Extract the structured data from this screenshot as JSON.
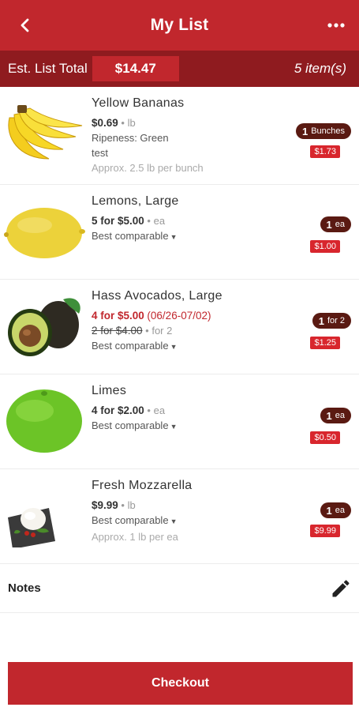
{
  "header": {
    "title": "My List",
    "back_icon": "chevron-left-icon",
    "more_icon": "more-dots-icon"
  },
  "total_bar": {
    "label": "Est. List Total",
    "amount": "$14.47",
    "count": "5 item(s)"
  },
  "items": [
    {
      "name": "Yellow Bananas",
      "price": "$0.69",
      "unit": "• lb",
      "detail_1": "Ripeness: Green",
      "detail_2": "test",
      "approx": "Approx. 2.5 lb per bunch",
      "qty_number": "1",
      "qty_unit": "Bunches",
      "subtotal": "$1.73",
      "image": "bananas"
    },
    {
      "name": "Lemons, Large",
      "price": "5 for $5.00",
      "unit": "• ea",
      "comparable": "Best comparable",
      "qty_number": "1",
      "qty_unit": "ea",
      "subtotal": "$1.00",
      "image": "lemon"
    },
    {
      "name": "Hass Avocados, Large",
      "sale_price": "4 for $5.00",
      "sale_dates": "(06/26-07/02)",
      "regular_price": "2 for $4.00",
      "regular_unit": "• for 2",
      "comparable": "Best comparable",
      "qty_number": "1",
      "qty_unit": "for 2",
      "subtotal": "$1.25",
      "image": "avocado"
    },
    {
      "name": "Limes",
      "price": "4 for $2.00",
      "unit": "• ea",
      "comparable": "Best comparable",
      "qty_number": "1",
      "qty_unit": "ea",
      "subtotal": "$0.50",
      "image": "lime"
    },
    {
      "name": "Fresh Mozzarella",
      "price": "$9.99",
      "unit": "• lb",
      "comparable": "Best comparable",
      "approx": "Approx. 1 lb per ea",
      "qty_number": "1",
      "qty_unit": "ea",
      "subtotal": "$9.99",
      "image": "mozzarella"
    }
  ],
  "notes": {
    "label": "Notes",
    "edit_icon": "pencil-icon"
  },
  "checkout": {
    "label": "Checkout"
  },
  "colors": {
    "brand_red": "#c1272d",
    "dark_red": "#8f1b1f",
    "pill_brown": "#5a1a12",
    "subtotal_red": "#d8262d"
  }
}
